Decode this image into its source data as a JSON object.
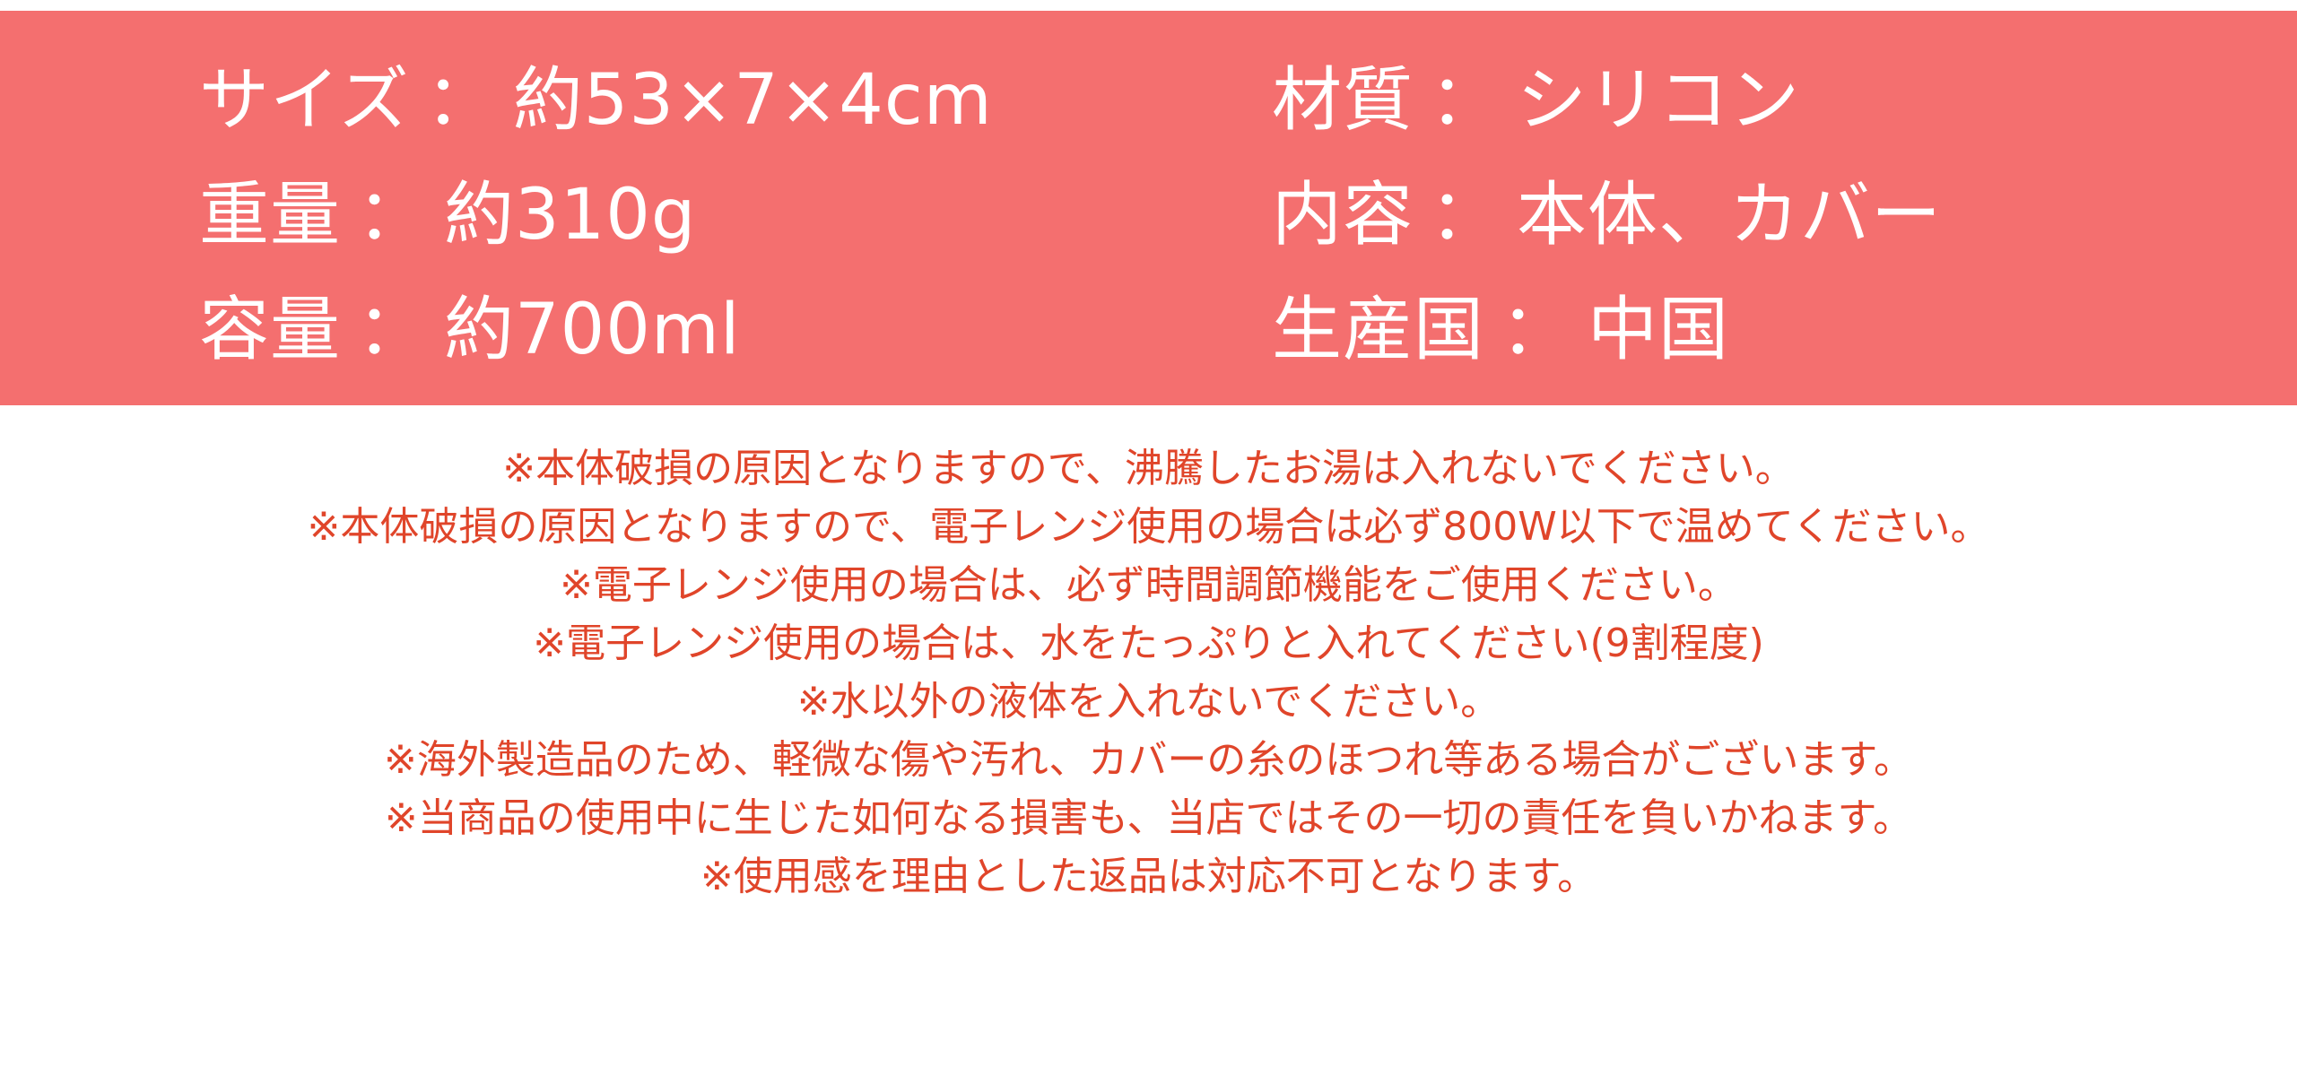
{
  "specs": {
    "left": [
      {
        "label": "サイズ",
        "value": "約53×7×4cm"
      },
      {
        "label": "重量",
        "value": "約310g"
      },
      {
        "label": "容量",
        "value": "約700ml"
      }
    ],
    "right": [
      {
        "label": "材質",
        "value": "シリコン"
      },
      {
        "label": "内容",
        "value": "本体、カバー"
      },
      {
        "label": "生産国",
        "value": "中国"
      }
    ],
    "separator": "："
  },
  "notes": [
    "※本体破損の原因となりますので、沸騰したお湯は入れないでください。",
    "※本体破損の原因となりますので、電子レンジ使用の場合は必ず800W以下で温めてください。",
    "※電子レンジ使用の場合は、必ず時間調節機能をご使用ください。",
    "※電子レンジ使用の場合は、水をたっぷりと入れてください(9割程度)",
    "※水以外の液体を入れないでください。",
    "※海外製造品のため、軽微な傷や汚れ、カバーの糸のほつれ等ある場合がございます。",
    "※当商品の使用中に生じた如何なる損害も、当店ではその一切の責任を負いかねます。",
    "※使用感を理由とした返品は対応不可となります。"
  ],
  "colors": {
    "panel_bg": "#f46f6f",
    "panel_text": "#ffffff",
    "note_text": "#e0452a"
  }
}
